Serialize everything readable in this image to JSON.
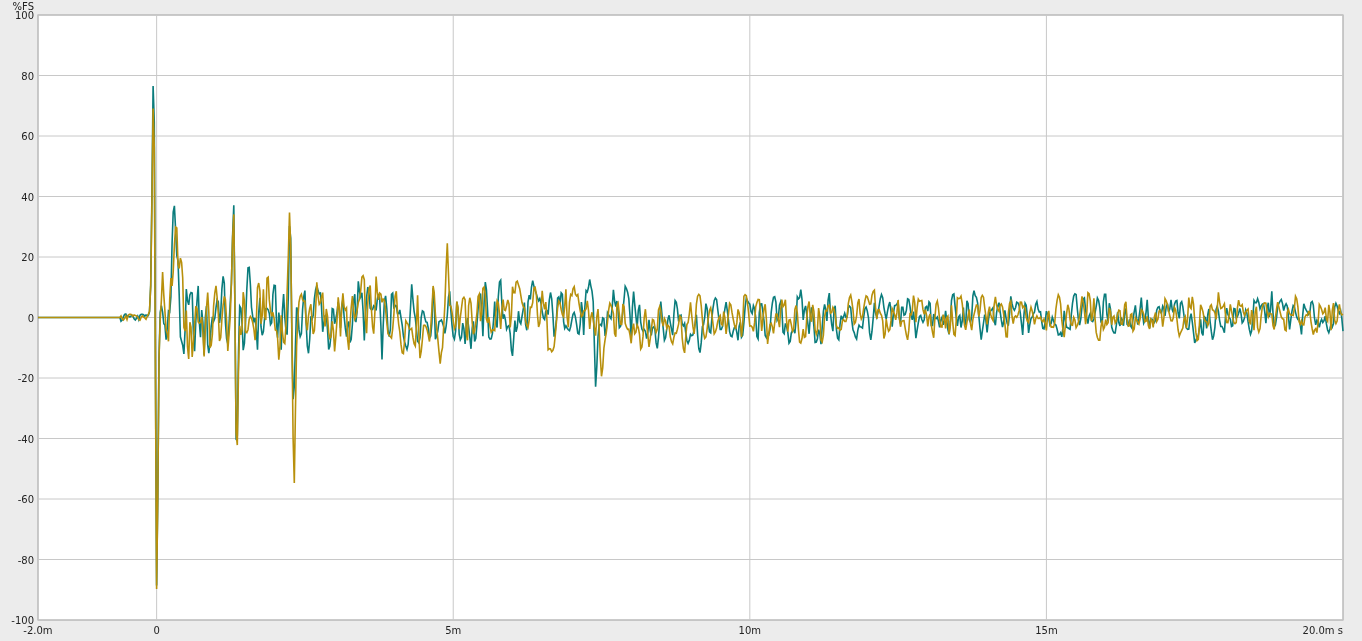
{
  "chart": {
    "y_unit": "%FS",
    "y_ticks": [
      "100",
      "80",
      "60",
      "40",
      "20",
      "0",
      "-20",
      "-40",
      "-60",
      "-80",
      "-100"
    ],
    "x_ticks": [
      "-2.0m",
      "0",
      "5m",
      "10m",
      "15m",
      "20.0m s"
    ]
  }
}
